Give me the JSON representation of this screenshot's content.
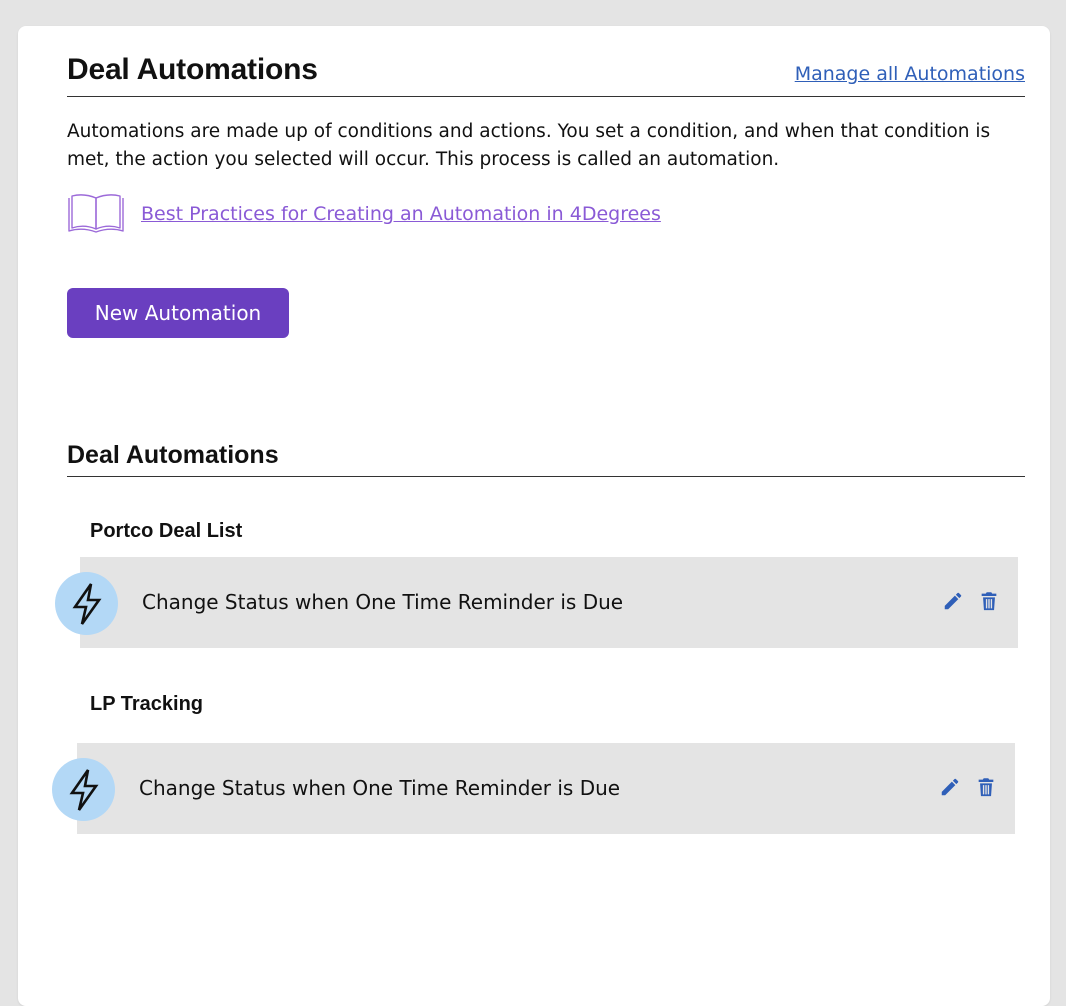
{
  "header": {
    "title": "Deal Automations",
    "manage_link": "Manage all Automations"
  },
  "intro": {
    "description": "Automations are made up of conditions and actions. You set a condition, and when that condition is met, the action you selected will occur. This process is called an automation.",
    "best_practices_link": "Best Practices for Creating an Automation in 4Degrees"
  },
  "actions": {
    "new_automation_label": "New Automation"
  },
  "section": {
    "title": "Deal Automations",
    "groups": [
      {
        "title": "Portco Deal List",
        "automations": [
          {
            "label": "Change Status when One Time Reminder is Due"
          }
        ]
      },
      {
        "title": "LP Tracking",
        "automations": [
          {
            "label": "Change Status when One Time Reminder is Due"
          }
        ]
      }
    ]
  },
  "icons": {
    "book": "book-icon",
    "bolt": "lightning-bolt-icon",
    "edit": "pencil-icon",
    "delete": "trash-icon"
  },
  "colors": {
    "background": "#e4e4e4",
    "card": "#ffffff",
    "primary_button": "#6a3fc0",
    "link_blue": "#2f5fb8",
    "link_purple": "#8a5ad6",
    "bolt_circle": "#b3d8f6",
    "row_background": "#e4e4e4",
    "icon_blue": "#2f5fb8"
  }
}
